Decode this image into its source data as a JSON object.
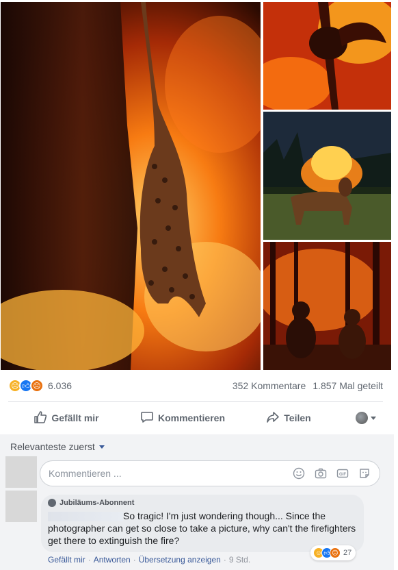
{
  "stats": {
    "reaction_count": "6.036",
    "comments": "352 Kommentare",
    "shares": "1.857 Mal geteilt"
  },
  "actions": {
    "like": "Gefällt mir",
    "comment": "Kommentieren",
    "share": "Teilen"
  },
  "comments": {
    "sort_label": "Relevanteste zuerst",
    "compose_placeholder": "Kommentieren ...",
    "first": {
      "badge": "Jubiläums-Abonnent",
      "text": "So tragic! I'm just wondering though... Since the photographer can get so close to take a picture, why can't the firefighters get there to extinguish the fire?",
      "reaction_count": "27",
      "like": "Gefällt mir",
      "reply": "Antworten",
      "translation": "Übersetzung anzeigen",
      "time": "9 Std."
    }
  },
  "colors": {
    "link": "#385898",
    "like_blue": "#1877f2",
    "reaction_yellow": "#f7b125",
    "reaction_orange": "#e9710f"
  },
  "icons": [
    "thumbs-up-icon",
    "speech-bubble-icon",
    "share-arrow-icon",
    "globe-icon",
    "chevron-down-icon",
    "emoji-icon",
    "camera-icon",
    "gif-icon",
    "sticker-icon"
  ]
}
